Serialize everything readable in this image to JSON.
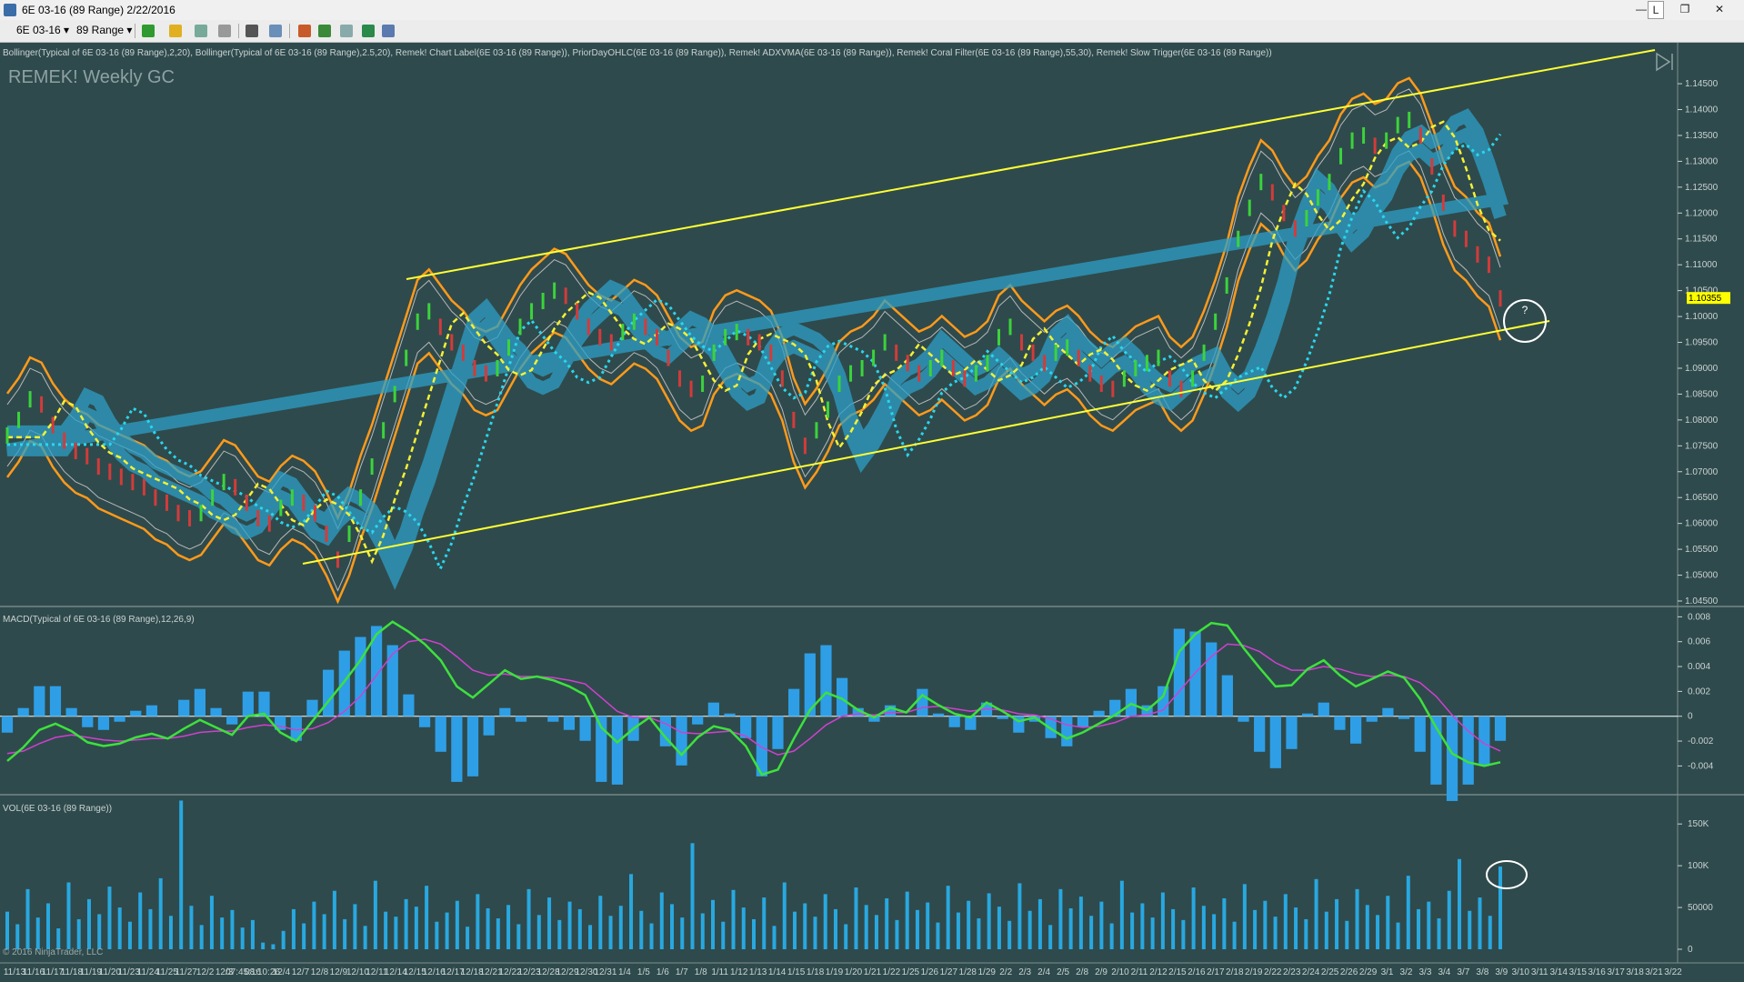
{
  "window": {
    "title": "6E 03-16 (89 Range)  2/22/2016",
    "controls": [
      "—",
      "L",
      "❐",
      "✕"
    ]
  },
  "toolbar": {
    "instrument": "6E 03-16",
    "period": "89 Range"
  },
  "indicator_line": "Bollinger(Typical of 6E 03-16 (89 Range),2,20), Bollinger(Typical of 6E 03-16 (89 Range),2.5,20), Remek! Chart Label(6E 03-16 (89 Range)), PriorDayOHLC(6E 03-16 (89 Range)), Remek! ADXVMA(6E 03-16 (89 Range)), Remek! Coral Filter(6E 03-16 (89 Range),55,30), Remek! Slow Trigger(6E 03-16 (89 Range))",
  "watermark": "REMEK! Weekly GC",
  "question_mark": "?",
  "copyright": "© 2016 NinjaTrader, LLC",
  "colors": {
    "background": "#2f4a4c",
    "channel": "#ffff33",
    "bollinger_outer": "#ff9a1a",
    "coral": "#2e9fc6",
    "slow_trigger": "#29d6ee",
    "adxvma": "#f5f033",
    "macd": "#3de13d",
    "signal": "#d040d0",
    "histogram": "#2e9fe6",
    "volume": "#28a8e0",
    "marker": "#ffffff",
    "last_price_bg": "#ffff00"
  },
  "chart_data": [
    {
      "panel": "price",
      "type": "line",
      "last_price": "1.10355",
      "y_ticks": [
        "1.14500",
        "1.14000",
        "1.13500",
        "1.13000",
        "1.12500",
        "1.12000",
        "1.11500",
        "1.11000",
        "1.10500",
        "1.10000",
        "1.09500",
        "1.09000",
        "1.08500",
        "1.08000",
        "1.07500",
        "1.07000",
        "1.06500",
        "1.06000",
        "1.05500",
        "1.05000",
        "1.04500"
      ],
      "ylim": [
        1.045,
        1.148
      ],
      "x_labels": [
        "11/13",
        "11/16",
        "11/17",
        "11/18",
        "11/19",
        "11/20",
        "11/23",
        "11/24",
        "11/25",
        "11/27",
        "12/2",
        "12/3",
        "07:45:16",
        "08:10:26",
        "12/4",
        "12/7",
        "12/8",
        "12/9",
        "12/10",
        "12/11",
        "12/14",
        "12/15",
        "12/16",
        "12/17",
        "12/18",
        "12/21",
        "12/22",
        "12/23",
        "12/28",
        "12/29",
        "12/30",
        "12/31",
        "1/4",
        "1/5",
        "1/6",
        "1/7",
        "1/8",
        "1/11",
        "1/12",
        "1/13",
        "1/14",
        "1/15",
        "1/18",
        "1/19",
        "1/20",
        "1/21",
        "1/22",
        "1/25",
        "1/26",
        "1/27",
        "1/28",
        "1/29",
        "2/2",
        "2/3",
        "2/4",
        "2/5",
        "2/8",
        "2/9",
        "2/10",
        "2/11",
        "2/12",
        "2/15",
        "2/16",
        "2/17",
        "2/18",
        "2/19",
        "2/22",
        "2/23",
        "2/24",
        "2/25",
        "2/26",
        "2/29",
        "3/1",
        "3/2",
        "3/3",
        "3/4",
        "3/7",
        "3/8",
        "3/9",
        "3/10",
        "3/11",
        "3/14",
        "3/15",
        "3/16",
        "3/17",
        "3/18",
        "3/21",
        "3/22"
      ],
      "series": [
        {
          "values": [
            1.077,
            1.08,
            1.084,
            1.083,
            1.079,
            1.076,
            1.074,
            1.073,
            1.071,
            1.07,
            1.069,
            1.068,
            1.067,
            1.065,
            1.064,
            1.062,
            1.061,
            1.062,
            1.065,
            1.068,
            1.067,
            1.064,
            1.061,
            1.06,
            1.063,
            1.065,
            1.064,
            1.062,
            1.058,
            1.053,
            1.058,
            1.065,
            1.071,
            1.078,
            1.085,
            1.092,
            1.099,
            1.101,
            1.098,
            1.095,
            1.093,
            1.09,
            1.089,
            1.09,
            1.094,
            1.098,
            1.101,
            1.103,
            1.105,
            1.104,
            1.101,
            1.098,
            1.096,
            1.095,
            1.097,
            1.099,
            1.098,
            1.096,
            1.092,
            1.088,
            1.086,
            1.087,
            1.093,
            1.096,
            1.097,
            1.096,
            1.095,
            1.093,
            1.088,
            1.08,
            1.075,
            1.078,
            1.082,
            1.087,
            1.089,
            1.09,
            1.092,
            1.095,
            1.093,
            1.091,
            1.089,
            1.09,
            1.092,
            1.09,
            1.088,
            1.089,
            1.091,
            1.096,
            1.098,
            1.095,
            1.093,
            1.091,
            1.093,
            1.094,
            1.092,
            1.089,
            1.087,
            1.086,
            1.088,
            1.09,
            1.091,
            1.092,
            1.088,
            1.086,
            1.088,
            1.093,
            1.099,
            1.106,
            1.115,
            1.121,
            1.126,
            1.124,
            1.12,
            1.117,
            1.119,
            1.123,
            1.126,
            1.131,
            1.134,
            1.135,
            1.133,
            1.134,
            1.137,
            1.138,
            1.135,
            1.129,
            1.122,
            1.117,
            1.115,
            1.112,
            1.11,
            1.1035
          ]
        }
      ]
    },
    {
      "panel": "macd",
      "type": "line",
      "label": "MACD(Typical of 6E 03-16 (89 Range),12,26,9)",
      "y_ticks": [
        "0.008",
        "0.006",
        "0.004",
        "0.002",
        "0",
        "-0.002",
        "-0.004"
      ],
      "ylim": [
        -0.0058,
        0.0081
      ],
      "series": [
        {
          "name": "MACD",
          "values": [
            -0.0036,
            -0.0025,
            -0.0011,
            -0.0006,
            -0.0012,
            -0.0021,
            -0.0024,
            -0.0022,
            -0.0017,
            -0.0014,
            -0.0018,
            -0.001,
            -0.0003,
            -0.0009,
            -0.0015,
            0.0,
            0.0002,
            -0.0013,
            -0.002,
            -0.0004,
            0.0012,
            0.0028,
            0.0045,
            0.0066,
            0.0076,
            0.0068,
            0.0058,
            0.0045,
            0.0024,
            0.0015,
            0.0026,
            0.0037,
            0.003,
            0.0032,
            0.0029,
            0.0024,
            0.0017,
            -0.0009,
            -0.0021,
            -0.001,
            -0.0001,
            -0.0017,
            -0.0031,
            -0.0017,
            -0.0008,
            -0.0011,
            -0.0024,
            -0.0047,
            -0.0043,
            -0.0018,
            0.0005,
            0.0019,
            0.0014,
            0.0005,
            -0.0001,
            0.0007,
            0.0003,
            0.0017,
            0.0009,
            0.0002,
            -0.0001,
            0.0011,
            0.0004,
            -0.0004,
            -0.0001,
            -0.001,
            -0.0018,
            -0.0013,
            -0.0006,
            0.0001,
            0.001,
            0.0005,
            0.0016,
            0.0052,
            0.0066,
            0.0075,
            0.0073,
            0.0055,
            0.0039,
            0.0024,
            0.0025,
            0.0038,
            0.0045,
            0.0033,
            0.0024,
            0.003,
            0.0036,
            0.0031,
            0.0014,
            -0.0009,
            -0.003,
            -0.0037,
            -0.004,
            -0.0037
          ]
        },
        {
          "name": "Signal",
          "values": [
            -0.003,
            -0.0028,
            -0.0022,
            -0.0017,
            -0.0015,
            -0.0017,
            -0.0019,
            -0.002,
            -0.0019,
            -0.0018,
            -0.0018,
            -0.0016,
            -0.0013,
            -0.0012,
            -0.0012,
            -0.0009,
            -0.0007,
            -0.0008,
            -0.0011,
            -0.001,
            -0.0005,
            0.0004,
            0.0016,
            0.0033,
            0.005,
            0.006,
            0.0062,
            0.0058,
            0.0048,
            0.0037,
            0.0033,
            0.0034,
            0.0032,
            0.0032,
            0.0031,
            0.0029,
            0.0026,
            0.0015,
            0.0004,
            -0.0001,
            -0.0001,
            -0.0006,
            -0.0013,
            -0.0014,
            -0.0013,
            -0.0012,
            -0.0016,
            -0.0025,
            -0.0031,
            -0.0028,
            -0.0018,
            -0.0007,
            0.0,
            0.0002,
            0.0001,
            0.0003,
            0.0003,
            0.0007,
            0.0008,
            0.0006,
            0.0004,
            0.0006,
            0.0005,
            0.0002,
            0.0001,
            -0.0002,
            -0.0007,
            -0.0009,
            -0.0008,
            -0.0005,
            0.0,
            0.0001,
            0.0005,
            0.002,
            0.0035,
            0.0048,
            0.0058,
            0.0057,
            0.0052,
            0.0043,
            0.0037,
            0.0037,
            0.004,
            0.0038,
            0.0034,
            0.0032,
            0.0033,
            0.0032,
            0.0027,
            0.0016,
            0.0001,
            -0.0012,
            -0.0022,
            -0.0028
          ]
        }
      ]
    },
    {
      "panel": "volume",
      "type": "bar",
      "label": "VOL(6E 03-16 (89 Range))",
      "y_ticks": [
        "150K",
        "100K",
        "50000",
        "0"
      ],
      "ylim": [
        0,
        160000
      ],
      "values": [
        45000,
        30000,
        72000,
        38000,
        55000,
        25000,
        80000,
        36000,
        60000,
        42000,
        75000,
        50000,
        33000,
        68000,
        48000,
        85000,
        40000,
        178000,
        52000,
        29000,
        64000,
        38000,
        47000,
        26000,
        35000,
        8000,
        6000,
        22000,
        48000,
        31000,
        57000,
        42000,
        70000,
        36000,
        54000,
        28000,
        82000,
        45000,
        39000,
        60000,
        51000,
        76000,
        33000,
        44000,
        58000,
        27000,
        66000,
        49000,
        37000,
        53000,
        30000,
        72000,
        41000,
        62000,
        35000,
        57000,
        48000,
        29000,
        64000,
        40000,
        52000,
        90000,
        46000,
        31000,
        68000,
        54000,
        38000,
        127000,
        43000,
        59000,
        33000,
        71000,
        50000,
        36000,
        62000,
        28000,
        80000,
        45000,
        55000,
        39000,
        66000,
        48000,
        30000,
        74000,
        53000,
        41000,
        61000,
        35000,
        69000,
        47000,
        56000,
        32000,
        76000,
        44000,
        58000,
        37000,
        67000,
        51000,
        34000,
        79000,
        46000,
        60000,
        29000,
        72000,
        49000,
        63000,
        40000,
        57000,
        31000,
        82000,
        44000,
        55000,
        38000,
        68000,
        48000,
        35000,
        74000,
        52000,
        42000,
        61000,
        33000,
        78000,
        47000,
        58000,
        39000,
        66000,
        50000,
        36000,
        84000,
        45000,
        60000,
        34000,
        72000,
        53000,
        41000,
        64000,
        32000,
        88000,
        48000,
        57000,
        37000,
        70000,
        108000,
        46000,
        62000,
        40000,
        99000
      ]
    }
  ]
}
